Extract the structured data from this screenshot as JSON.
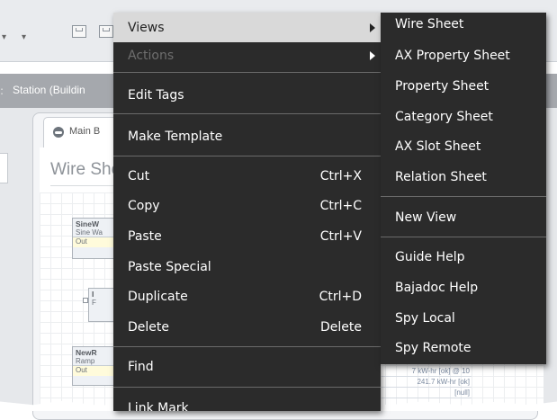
{
  "breadcrumb": {
    "station": "Station (Buildin"
  },
  "tab": {
    "label": "Main B"
  },
  "view": {
    "title": "Wire She"
  },
  "components": {
    "sine": {
      "title": "SineW",
      "subtitle": "Sine Wa",
      "slot": "Out"
    },
    "mid": {
      "title": "I",
      "subtitle": "F"
    },
    "ramp": {
      "title": "NewR",
      "subtitle": "Ramp",
      "slot": "Out"
    }
  },
  "readouts": [
    "7 kW-hr [ok] @ 10",
    "241.7 kW-hr [ok]",
    "[null]"
  ],
  "context_menu": {
    "items": [
      {
        "label": "Views",
        "has_submenu": true,
        "state": "highlighted"
      },
      {
        "label": "Actions",
        "has_submenu": true,
        "state": "disabled"
      },
      {
        "label": "Edit Tags"
      },
      {
        "label": "Make Template"
      },
      {
        "label": "Cut",
        "shortcut": "Ctrl+X"
      },
      {
        "label": "Copy",
        "shortcut": "Ctrl+C"
      },
      {
        "label": "Paste",
        "shortcut": "Ctrl+V"
      },
      {
        "label": "Paste Special"
      },
      {
        "label": "Duplicate",
        "shortcut": "Ctrl+D"
      },
      {
        "label": "Delete",
        "shortcut": "Delete"
      },
      {
        "label": "Find"
      },
      {
        "label": "Link Mark"
      }
    ]
  },
  "views_submenu": {
    "items": [
      "Wire Sheet",
      "AX Property Sheet",
      "Property Sheet",
      "Category Sheet",
      "AX Slot Sheet",
      "Relation Sheet",
      "New View",
      "Guide Help",
      "Bajadoc Help",
      "Spy Local",
      "Spy Remote"
    ]
  },
  "colors": {
    "menu_bg": "#2b2b2b",
    "menu_text": "#ffffff",
    "highlight_bg": "#d9d9d9",
    "disabled_text": "#6e6e6e",
    "breadcrumb_bar": "#a5a8ad"
  },
  "icons": {
    "submenu_arrow": "chevron-right-icon",
    "tab_icon": "globe-icon",
    "toolbar_save": "save-icon"
  }
}
